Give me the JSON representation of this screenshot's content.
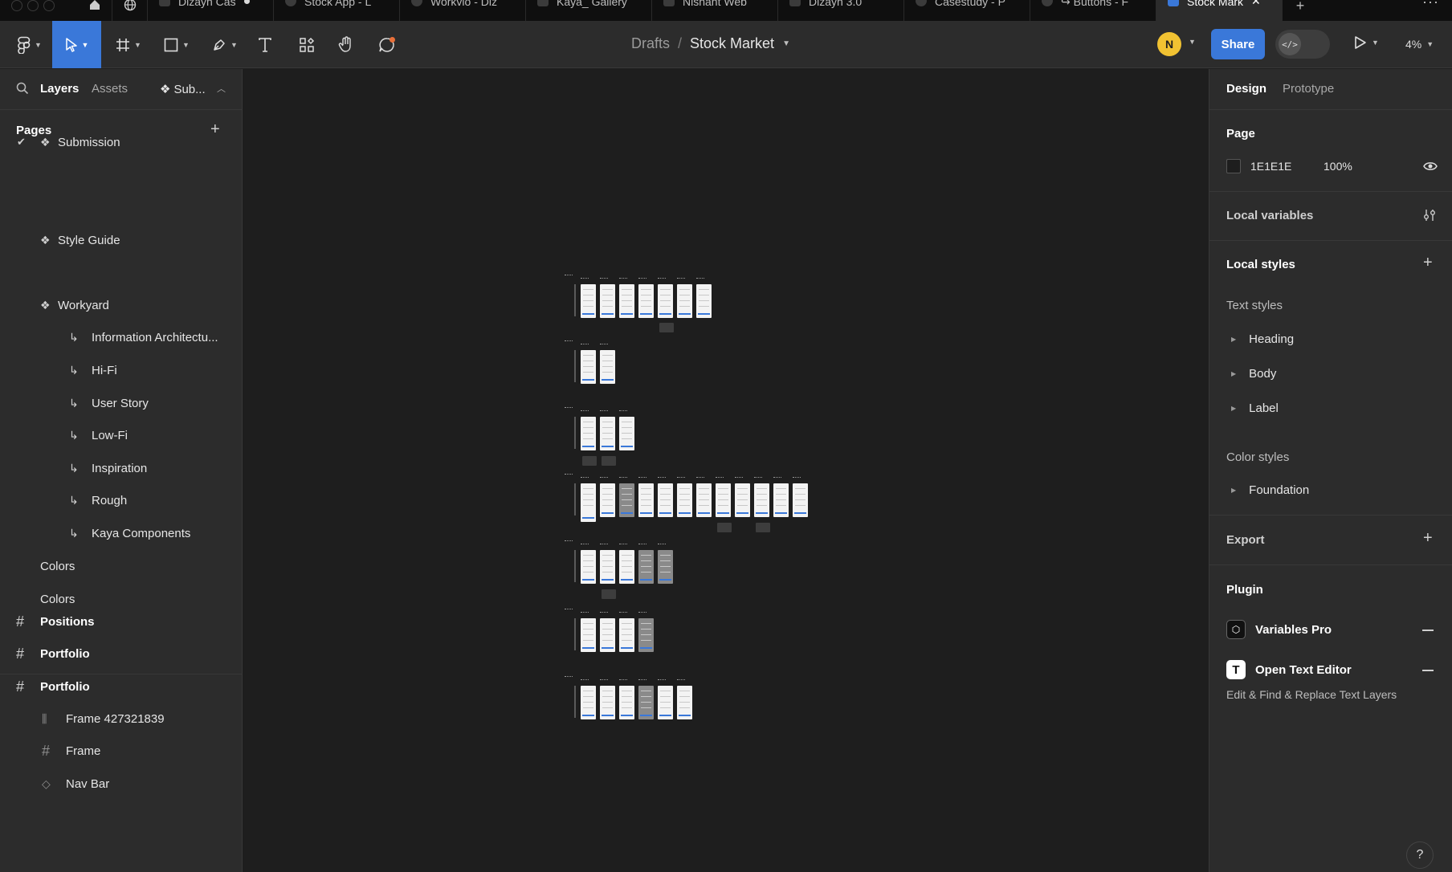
{
  "tabs": [
    {
      "label": "Dizayn Cas",
      "kind": "design",
      "unsaved": true,
      "active": false
    },
    {
      "label": "Stock App - L",
      "kind": "prototype",
      "active": false
    },
    {
      "label": "Workvio - Diz",
      "kind": "prototype",
      "active": false
    },
    {
      "label": "Kaya_ Gallery",
      "kind": "design",
      "active": false
    },
    {
      "label": "Nishant Web",
      "kind": "design",
      "active": false
    },
    {
      "label": "Dizayn 3.0",
      "kind": "design",
      "active": false
    },
    {
      "label": "Casestudy - P",
      "kind": "prototype",
      "active": false
    },
    {
      "label": "↪ Buttons - F",
      "kind": "prototype",
      "active": false
    },
    {
      "label": "Stock Mark",
      "kind": "design",
      "active": true
    }
  ],
  "toolbar": {
    "breadcrumb_drafts": "Drafts",
    "breadcrumb_sep": "/",
    "file_name": "Stock Market",
    "avatar_initial": "N",
    "share_label": "Share",
    "zoom_level": "4%",
    "accent": "#3a78d9"
  },
  "left_panel": {
    "tab_layers": "Layers",
    "tab_assets": "Assets",
    "current_page_short": "Sub...",
    "pages_heading": "Pages",
    "pages": [
      {
        "label": "Submission",
        "current": true,
        "component": true
      },
      {
        "label": "Style Guide",
        "component": true
      },
      {
        "label": "Workyard",
        "component": true
      },
      {
        "label": "Information Architectu...",
        "sub": true
      },
      {
        "label": "Hi-Fi",
        "sub": true
      },
      {
        "label": "User Story",
        "sub": true
      },
      {
        "label": "Low-Fi",
        "sub": true
      },
      {
        "label": "Inspiration",
        "sub": true
      },
      {
        "label": "Rough",
        "sub": true
      },
      {
        "label": "Kaya Components",
        "sub": true
      },
      {
        "label": "Colors"
      },
      {
        "label": "Colors"
      }
    ],
    "layers": [
      {
        "label": "Positions",
        "icon": "frame-icon",
        "bold": true
      },
      {
        "label": "Portfolio",
        "icon": "frame-icon",
        "bold": true
      },
      {
        "label": "Portfolio",
        "icon": "frame-icon",
        "bold": true
      },
      {
        "label": "Frame 427321839",
        "icon": "autolayout-icon",
        "bold": false
      },
      {
        "label": "Frame",
        "icon": "frame-icon",
        "bold": false
      },
      {
        "label": "Nav Bar",
        "icon": "component-instance-icon",
        "bold": false
      }
    ]
  },
  "right_panel": {
    "tab_design": "Design",
    "tab_prototype": "Prototype",
    "page_heading": "Page",
    "page_color_hex": "1E1E1E",
    "page_opacity": "100%",
    "local_variables": "Local variables",
    "local_styles": "Local styles",
    "text_styles_heading": "Text styles",
    "text_styles": [
      "Heading",
      "Body",
      "Label"
    ],
    "color_styles_heading": "Color styles",
    "color_styles": [
      "Foundation"
    ],
    "export_heading": "Export",
    "plugin_heading": "Plugin",
    "plugins": [
      {
        "name": "Variables Pro",
        "icon": "variables-pro-icon"
      },
      {
        "name": "Open Text Editor",
        "icon": "text-editor-icon",
        "description": "Edit & Find & Replace Text Layers"
      }
    ]
  },
  "help_label": "?"
}
